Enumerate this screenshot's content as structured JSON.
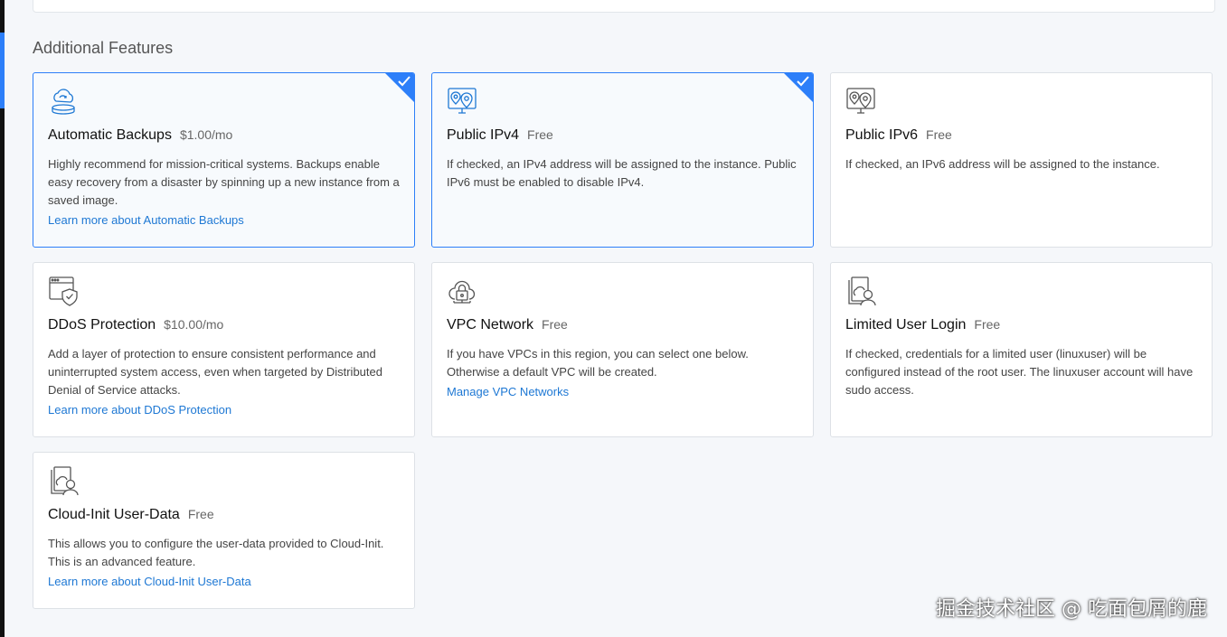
{
  "section": {
    "title": "Additional Features"
  },
  "colors": {
    "accent": "#2d7ff9",
    "link": "#1e78d4"
  },
  "cards": {
    "backups": {
      "icon": "cloud-backup-icon",
      "name": "Automatic Backups",
      "price": "$1.00/mo",
      "desc": "Highly recommend for mission-critical systems. Backups enable easy recovery from a disaster by spinning up a new instance from a saved image.",
      "link": "Learn more about Automatic Backups",
      "selected": true
    },
    "ipv4": {
      "icon": "map-pin-monitor-icon",
      "name": "Public IPv4",
      "price": "Free",
      "desc": "If checked, an IPv4 address will be assigned to the instance. Public IPv6 must be enabled to disable IPv4.",
      "selected": true
    },
    "ipv6": {
      "icon": "map-pin-monitor-icon",
      "name": "Public IPv6",
      "price": "Free",
      "desc": "If checked, an IPv6 address will be assigned to the instance.",
      "selected": false
    },
    "ddos": {
      "icon": "browser-shield-icon",
      "name": "DDoS Protection",
      "price": "$10.00/mo",
      "desc": "Add a layer of protection to ensure consistent performance and uninterrupted system access, even when targeted by Distributed Denial of Service attacks.",
      "link": "Learn more about DDoS Protection",
      "selected": false
    },
    "vpc": {
      "icon": "cloud-lock-icon",
      "name": "VPC Network",
      "price": "Free",
      "desc": "If you have VPCs in this region, you can select one below. Otherwise a default VPC will be created.",
      "link": "Manage VPC Networks",
      "selected": false
    },
    "limited_user": {
      "icon": "document-user-icon",
      "name": "Limited User Login",
      "price": "Free",
      "desc": "If checked, credentials for a limited user (linuxuser) will be configured instead of the root user. The linuxuser account will have sudo access.",
      "selected": false
    },
    "cloud_init": {
      "icon": "document-user-icon",
      "name": "Cloud-Init User-Data",
      "price": "Free",
      "desc": "This allows you to configure the user-data provided to Cloud-Init. This is an advanced feature.",
      "link": "Learn more about Cloud-Init User-Data",
      "selected": false
    }
  },
  "watermark": "掘金技术社区 @ 吃面包屑的鹿"
}
